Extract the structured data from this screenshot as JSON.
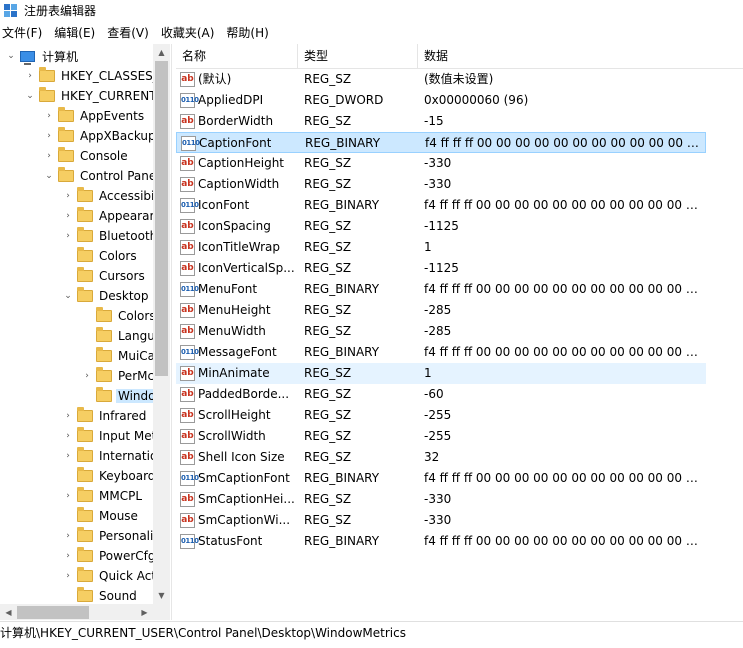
{
  "window": {
    "title": "注册表编辑器"
  },
  "menu": {
    "file": "文件(F)",
    "edit": "编辑(E)",
    "view": "查看(V)",
    "favorites": "收藏夹(A)",
    "help": "帮助(H)"
  },
  "tree": {
    "nodes": [
      {
        "label": "计算机",
        "level": 0,
        "expander": "down",
        "icon": "computer-icon"
      },
      {
        "label": "HKEY_CLASSES_I",
        "level": 1,
        "expander": "right",
        "icon": "folder-icon"
      },
      {
        "label": "HKEY_CURRENT",
        "level": 1,
        "expander": "down",
        "icon": "folder-icon"
      },
      {
        "label": "AppEvents",
        "level": 2,
        "expander": "right",
        "icon": "folder-icon"
      },
      {
        "label": "AppXBackup",
        "level": 2,
        "expander": "right",
        "icon": "folder-icon"
      },
      {
        "label": "Console",
        "level": 2,
        "expander": "right",
        "icon": "folder-icon"
      },
      {
        "label": "Control Pane",
        "level": 2,
        "expander": "down",
        "icon": "folder-icon"
      },
      {
        "label": "Accessibil",
        "level": 3,
        "expander": "right",
        "icon": "folder-icon"
      },
      {
        "label": "Appearar",
        "level": 3,
        "expander": "right",
        "icon": "folder-icon"
      },
      {
        "label": "Bluetooth",
        "level": 3,
        "expander": "right",
        "icon": "folder-icon"
      },
      {
        "label": "Colors",
        "level": 3,
        "expander": "",
        "icon": "folder-icon"
      },
      {
        "label": "Cursors",
        "level": 3,
        "expander": "",
        "icon": "folder-icon"
      },
      {
        "label": "Desktop",
        "level": 3,
        "expander": "down",
        "icon": "folder-icon"
      },
      {
        "label": "Colors",
        "level": 4,
        "expander": "",
        "icon": "folder-icon"
      },
      {
        "label": "Langu",
        "level": 4,
        "expander": "",
        "icon": "folder-icon"
      },
      {
        "label": "MuiCa",
        "level": 4,
        "expander": "",
        "icon": "folder-icon"
      },
      {
        "label": "PerMc",
        "level": 4,
        "expander": "right",
        "icon": "folder-icon"
      },
      {
        "label": "Windo",
        "level": 4,
        "expander": "",
        "icon": "folder-icon",
        "selected": true
      },
      {
        "label": "Infrared",
        "level": 3,
        "expander": "right",
        "icon": "folder-icon"
      },
      {
        "label": "Input Met",
        "level": 3,
        "expander": "right",
        "icon": "folder-icon"
      },
      {
        "label": "Internatio",
        "level": 3,
        "expander": "right",
        "icon": "folder-icon"
      },
      {
        "label": "Keyboard",
        "level": 3,
        "expander": "",
        "icon": "folder-icon"
      },
      {
        "label": "MMCPL",
        "level": 3,
        "expander": "right",
        "icon": "folder-icon"
      },
      {
        "label": "Mouse",
        "level": 3,
        "expander": "",
        "icon": "folder-icon"
      },
      {
        "label": "Personali:",
        "level": 3,
        "expander": "right",
        "icon": "folder-icon"
      },
      {
        "label": "PowerCfg",
        "level": 3,
        "expander": "right",
        "icon": "folder-icon"
      },
      {
        "label": "Quick Act",
        "level": 3,
        "expander": "right",
        "icon": "folder-icon"
      },
      {
        "label": "Sound",
        "level": 3,
        "expander": "",
        "icon": "folder-icon"
      }
    ]
  },
  "list": {
    "columns": {
      "name": "名称",
      "type": "类型",
      "data": "数据"
    },
    "rows": [
      {
        "name": "(默认)",
        "type": "REG_SZ",
        "data": "(数值未设置)",
        "icon": "sz"
      },
      {
        "name": "AppliedDPI",
        "type": "REG_DWORD",
        "data": "0x00000060 (96)",
        "icon": "dword"
      },
      {
        "name": "BorderWidth",
        "type": "REG_SZ",
        "data": "-15",
        "icon": "sz"
      },
      {
        "name": "CaptionFont",
        "type": "REG_BINARY",
        "data": "f4 ff ff ff 00 00 00 00 00 00 00 00 00 00 00 00...",
        "icon": "bin",
        "selected": true
      },
      {
        "name": "CaptionHeight",
        "type": "REG_SZ",
        "data": "-330",
        "icon": "sz"
      },
      {
        "name": "CaptionWidth",
        "type": "REG_SZ",
        "data": "-330",
        "icon": "sz"
      },
      {
        "name": "IconFont",
        "type": "REG_BINARY",
        "data": "f4 ff ff ff 00 00 00 00 00 00 00 00 00 00 00 00...",
        "icon": "bin"
      },
      {
        "name": "IconSpacing",
        "type": "REG_SZ",
        "data": "-1125",
        "icon": "sz"
      },
      {
        "name": "IconTitleWrap",
        "type": "REG_SZ",
        "data": "1",
        "icon": "sz"
      },
      {
        "name": "IconVerticalSp...",
        "type": "REG_SZ",
        "data": "-1125",
        "icon": "sz"
      },
      {
        "name": "MenuFont",
        "type": "REG_BINARY",
        "data": "f4 ff ff ff 00 00 00 00 00 00 00 00 00 00 00 00...",
        "icon": "bin"
      },
      {
        "name": "MenuHeight",
        "type": "REG_SZ",
        "data": "-285",
        "icon": "sz"
      },
      {
        "name": "MenuWidth",
        "type": "REG_SZ",
        "data": "-285",
        "icon": "sz"
      },
      {
        "name": "MessageFont",
        "type": "REG_BINARY",
        "data": "f4 ff ff ff 00 00 00 00 00 00 00 00 00 00 00 00...",
        "icon": "bin"
      },
      {
        "name": "MinAnimate",
        "type": "REG_SZ",
        "data": "1",
        "icon": "sz",
        "hover": true
      },
      {
        "name": "PaddedBorde...",
        "type": "REG_SZ",
        "data": "-60",
        "icon": "sz"
      },
      {
        "name": "ScrollHeight",
        "type": "REG_SZ",
        "data": "-255",
        "icon": "sz"
      },
      {
        "name": "ScrollWidth",
        "type": "REG_SZ",
        "data": "-255",
        "icon": "sz"
      },
      {
        "name": "Shell Icon Size",
        "type": "REG_SZ",
        "data": "32",
        "icon": "sz"
      },
      {
        "name": "SmCaptionFont",
        "type": "REG_BINARY",
        "data": "f4 ff ff ff 00 00 00 00 00 00 00 00 00 00 00 00...",
        "icon": "bin"
      },
      {
        "name": "SmCaptionHei...",
        "type": "REG_SZ",
        "data": "-330",
        "icon": "sz"
      },
      {
        "name": "SmCaptionWi...",
        "type": "REG_SZ",
        "data": "-330",
        "icon": "sz"
      },
      {
        "name": "StatusFont",
        "type": "REG_BINARY",
        "data": "f4 ff ff ff 00 00 00 00 00 00 00 00 00 00 00 00...",
        "icon": "bin"
      }
    ]
  },
  "status": {
    "path": "计算机\\HKEY_CURRENT_USER\\Control Panel\\Desktop\\WindowMetrics"
  },
  "colors": {
    "selection": "#cce8ff",
    "selection_border": "#99d1ff",
    "hover": "#e5f3ff",
    "folder": "#f6ce63"
  }
}
